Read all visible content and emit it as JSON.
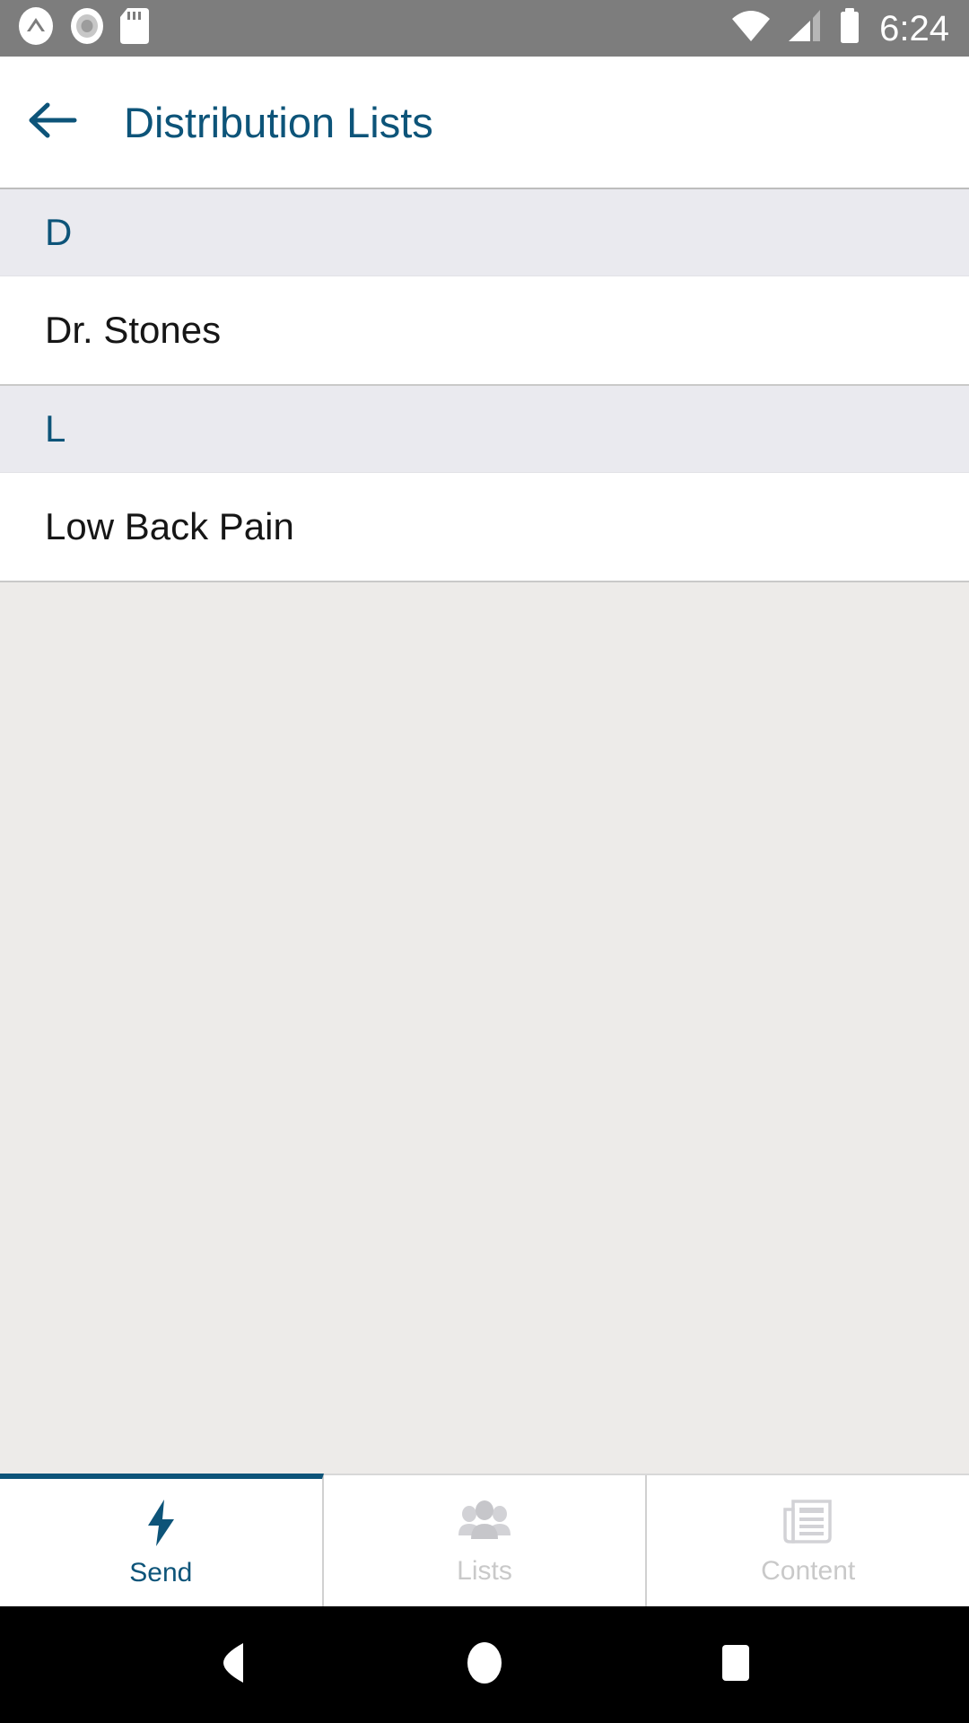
{
  "status_bar": {
    "background": "#7d7d7d",
    "time": "6:24",
    "left_icons": [
      "caret-circle-icon",
      "record-circle-icon",
      "sd-card-icon"
    ],
    "right_icons": [
      "wifi-icon",
      "cellular-signal-icon",
      "battery-icon"
    ]
  },
  "app_bar": {
    "back_icon": "arrow-left-icon",
    "title": "Distribution Lists",
    "title_color": "#0d5479",
    "background": "#ffffff"
  },
  "list": {
    "background": "#edebe9",
    "section_header_background": "#eaeaef",
    "section_header_color": "#0d5479",
    "item_color": "#161616",
    "sections": [
      {
        "letter": "D",
        "items": [
          {
            "label": "Dr. Stones"
          }
        ]
      },
      {
        "letter": "L",
        "items": [
          {
            "label": "Low Back Pain"
          }
        ]
      }
    ]
  },
  "tab_bar": {
    "active_color": "#0d5479",
    "inactive_color": "#c9c9c9",
    "tabs": [
      {
        "label": "Send",
        "icon": "lightning-bolt-icon",
        "active": true
      },
      {
        "label": "Lists",
        "icon": "people-group-icon",
        "active": false
      },
      {
        "label": "Content",
        "icon": "newspaper-icon",
        "active": false
      }
    ]
  },
  "nav_bar": {
    "background": "#000000",
    "buttons": [
      {
        "name": "back-triangle-icon"
      },
      {
        "name": "home-circle-icon"
      },
      {
        "name": "recents-square-icon"
      }
    ]
  }
}
